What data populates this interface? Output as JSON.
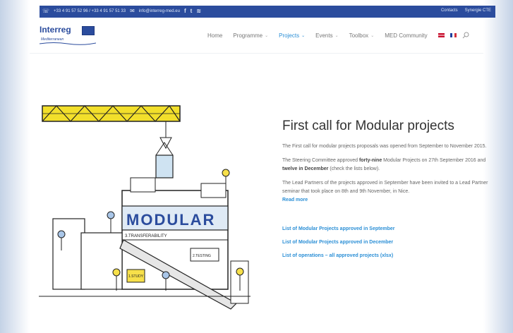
{
  "topbar": {
    "phone": "+33 4 91 57 52 96 / +33 4 91 57 51 33",
    "email": "info@interreg-med.eu",
    "social_icons": [
      "facebook-icon",
      "twitter-icon",
      "rss-icon"
    ],
    "right_links": [
      "Contacts",
      "Synergie CTE"
    ],
    "color": "#2b4c9d"
  },
  "logo": {
    "title": "Interreg",
    "subtitle": "Mediterranean"
  },
  "nav": {
    "items": [
      {
        "label": "Home",
        "has_dropdown": false,
        "active": false
      },
      {
        "label": "Programme",
        "has_dropdown": true,
        "active": false
      },
      {
        "label": "Projects",
        "has_dropdown": true,
        "active": true
      },
      {
        "label": "Events",
        "has_dropdown": true,
        "active": false
      },
      {
        "label": "Toolbox",
        "has_dropdown": true,
        "active": false
      },
      {
        "label": "MED Community",
        "has_dropdown": false,
        "active": false
      }
    ],
    "languages": [
      "en-flag-icon",
      "fr-flag-icon"
    ],
    "accent": "#2b8fd6"
  },
  "illustration": {
    "word": "MODULAR",
    "labels": [
      "3.TRANSFERABILITY",
      "2.TESTING",
      "1.STUDY"
    ]
  },
  "article": {
    "title": "First call for Modular projects",
    "p1": "The First call for modular projects proposals was opened from September to November 2015.",
    "p2_pre": "The Steering Committee approved ",
    "p2_b1": "forty-nine",
    "p2_mid": " Modular Projects on 27th September 2016 and ",
    "p2_b2": "twelve in December",
    "p2_post": " (check the lists below).",
    "p3": "The Lead Partners of the projects approved in September have been invited to a Lead Partner seminar that took place on 8th and 9th November, in Nice.",
    "read_more": "Read more",
    "links": [
      "List of Modular Projects approved in September",
      "List of Modular Projects approved in December",
      "List of operations – all approved projects (xlsx)"
    ]
  }
}
